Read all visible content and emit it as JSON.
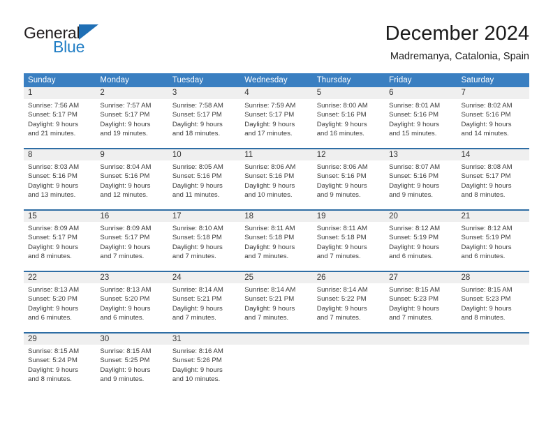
{
  "brand": {
    "name_top": "General",
    "name_bottom": "Blue",
    "accent_color": "#1f7dc4",
    "triangle_color": "#1f6fb5"
  },
  "header": {
    "title": "December 2024",
    "subtitle": "Madremanya, Catalonia, Spain"
  },
  "colors": {
    "header_row_bg": "#3a7fc1",
    "daynum_bg": "#efefef",
    "week_separator": "#2e6da4",
    "text": "#3a3a3a"
  },
  "weekday_headers": [
    "Sunday",
    "Monday",
    "Tuesday",
    "Wednesday",
    "Thursday",
    "Friday",
    "Saturday"
  ],
  "weeks": [
    {
      "daynums": [
        "1",
        "2",
        "3",
        "4",
        "5",
        "6",
        "7"
      ],
      "cells": [
        {
          "sunrise": "Sunrise: 7:56 AM",
          "sunset": "Sunset: 5:17 PM",
          "daylight1": "Daylight: 9 hours",
          "daylight2": "and 21 minutes."
        },
        {
          "sunrise": "Sunrise: 7:57 AM",
          "sunset": "Sunset: 5:17 PM",
          "daylight1": "Daylight: 9 hours",
          "daylight2": "and 19 minutes."
        },
        {
          "sunrise": "Sunrise: 7:58 AM",
          "sunset": "Sunset: 5:17 PM",
          "daylight1": "Daylight: 9 hours",
          "daylight2": "and 18 minutes."
        },
        {
          "sunrise": "Sunrise: 7:59 AM",
          "sunset": "Sunset: 5:17 PM",
          "daylight1": "Daylight: 9 hours",
          "daylight2": "and 17 minutes."
        },
        {
          "sunrise": "Sunrise: 8:00 AM",
          "sunset": "Sunset: 5:16 PM",
          "daylight1": "Daylight: 9 hours",
          "daylight2": "and 16 minutes."
        },
        {
          "sunrise": "Sunrise: 8:01 AM",
          "sunset": "Sunset: 5:16 PM",
          "daylight1": "Daylight: 9 hours",
          "daylight2": "and 15 minutes."
        },
        {
          "sunrise": "Sunrise: 8:02 AM",
          "sunset": "Sunset: 5:16 PM",
          "daylight1": "Daylight: 9 hours",
          "daylight2": "and 14 minutes."
        }
      ]
    },
    {
      "daynums": [
        "8",
        "9",
        "10",
        "11",
        "12",
        "13",
        "14"
      ],
      "cells": [
        {
          "sunrise": "Sunrise: 8:03 AM",
          "sunset": "Sunset: 5:16 PM",
          "daylight1": "Daylight: 9 hours",
          "daylight2": "and 13 minutes."
        },
        {
          "sunrise": "Sunrise: 8:04 AM",
          "sunset": "Sunset: 5:16 PM",
          "daylight1": "Daylight: 9 hours",
          "daylight2": "and 12 minutes."
        },
        {
          "sunrise": "Sunrise: 8:05 AM",
          "sunset": "Sunset: 5:16 PM",
          "daylight1": "Daylight: 9 hours",
          "daylight2": "and 11 minutes."
        },
        {
          "sunrise": "Sunrise: 8:06 AM",
          "sunset": "Sunset: 5:16 PM",
          "daylight1": "Daylight: 9 hours",
          "daylight2": "and 10 minutes."
        },
        {
          "sunrise": "Sunrise: 8:06 AM",
          "sunset": "Sunset: 5:16 PM",
          "daylight1": "Daylight: 9 hours",
          "daylight2": "and 9 minutes."
        },
        {
          "sunrise": "Sunrise: 8:07 AM",
          "sunset": "Sunset: 5:16 PM",
          "daylight1": "Daylight: 9 hours",
          "daylight2": "and 9 minutes."
        },
        {
          "sunrise": "Sunrise: 8:08 AM",
          "sunset": "Sunset: 5:17 PM",
          "daylight1": "Daylight: 9 hours",
          "daylight2": "and 8 minutes."
        }
      ]
    },
    {
      "daynums": [
        "15",
        "16",
        "17",
        "18",
        "19",
        "20",
        "21"
      ],
      "cells": [
        {
          "sunrise": "Sunrise: 8:09 AM",
          "sunset": "Sunset: 5:17 PM",
          "daylight1": "Daylight: 9 hours",
          "daylight2": "and 8 minutes."
        },
        {
          "sunrise": "Sunrise: 8:09 AM",
          "sunset": "Sunset: 5:17 PM",
          "daylight1": "Daylight: 9 hours",
          "daylight2": "and 7 minutes."
        },
        {
          "sunrise": "Sunrise: 8:10 AM",
          "sunset": "Sunset: 5:18 PM",
          "daylight1": "Daylight: 9 hours",
          "daylight2": "and 7 minutes."
        },
        {
          "sunrise": "Sunrise: 8:11 AM",
          "sunset": "Sunset: 5:18 PM",
          "daylight1": "Daylight: 9 hours",
          "daylight2": "and 7 minutes."
        },
        {
          "sunrise": "Sunrise: 8:11 AM",
          "sunset": "Sunset: 5:18 PM",
          "daylight1": "Daylight: 9 hours",
          "daylight2": "and 7 minutes."
        },
        {
          "sunrise": "Sunrise: 8:12 AM",
          "sunset": "Sunset: 5:19 PM",
          "daylight1": "Daylight: 9 hours",
          "daylight2": "and 6 minutes."
        },
        {
          "sunrise": "Sunrise: 8:12 AM",
          "sunset": "Sunset: 5:19 PM",
          "daylight1": "Daylight: 9 hours",
          "daylight2": "and 6 minutes."
        }
      ]
    },
    {
      "daynums": [
        "22",
        "23",
        "24",
        "25",
        "26",
        "27",
        "28"
      ],
      "cells": [
        {
          "sunrise": "Sunrise: 8:13 AM",
          "sunset": "Sunset: 5:20 PM",
          "daylight1": "Daylight: 9 hours",
          "daylight2": "and 6 minutes."
        },
        {
          "sunrise": "Sunrise: 8:13 AM",
          "sunset": "Sunset: 5:20 PM",
          "daylight1": "Daylight: 9 hours",
          "daylight2": "and 6 minutes."
        },
        {
          "sunrise": "Sunrise: 8:14 AM",
          "sunset": "Sunset: 5:21 PM",
          "daylight1": "Daylight: 9 hours",
          "daylight2": "and 7 minutes."
        },
        {
          "sunrise": "Sunrise: 8:14 AM",
          "sunset": "Sunset: 5:21 PM",
          "daylight1": "Daylight: 9 hours",
          "daylight2": "and 7 minutes."
        },
        {
          "sunrise": "Sunrise: 8:14 AM",
          "sunset": "Sunset: 5:22 PM",
          "daylight1": "Daylight: 9 hours",
          "daylight2": "and 7 minutes."
        },
        {
          "sunrise": "Sunrise: 8:15 AM",
          "sunset": "Sunset: 5:23 PM",
          "daylight1": "Daylight: 9 hours",
          "daylight2": "and 7 minutes."
        },
        {
          "sunrise": "Sunrise: 8:15 AM",
          "sunset": "Sunset: 5:23 PM",
          "daylight1": "Daylight: 9 hours",
          "daylight2": "and 8 minutes."
        }
      ]
    },
    {
      "daynums": [
        "29",
        "30",
        "31",
        "",
        "",
        "",
        ""
      ],
      "cells": [
        {
          "sunrise": "Sunrise: 8:15 AM",
          "sunset": "Sunset: 5:24 PM",
          "daylight1": "Daylight: 9 hours",
          "daylight2": "and 8 minutes."
        },
        {
          "sunrise": "Sunrise: 8:15 AM",
          "sunset": "Sunset: 5:25 PM",
          "daylight1": "Daylight: 9 hours",
          "daylight2": "and 9 minutes."
        },
        {
          "sunrise": "Sunrise: 8:16 AM",
          "sunset": "Sunset: 5:26 PM",
          "daylight1": "Daylight: 9 hours",
          "daylight2": "and 10 minutes."
        },
        {
          "sunrise": "",
          "sunset": "",
          "daylight1": "",
          "daylight2": ""
        },
        {
          "sunrise": "",
          "sunset": "",
          "daylight1": "",
          "daylight2": ""
        },
        {
          "sunrise": "",
          "sunset": "",
          "daylight1": "",
          "daylight2": ""
        },
        {
          "sunrise": "",
          "sunset": "",
          "daylight1": "",
          "daylight2": ""
        }
      ]
    }
  ]
}
